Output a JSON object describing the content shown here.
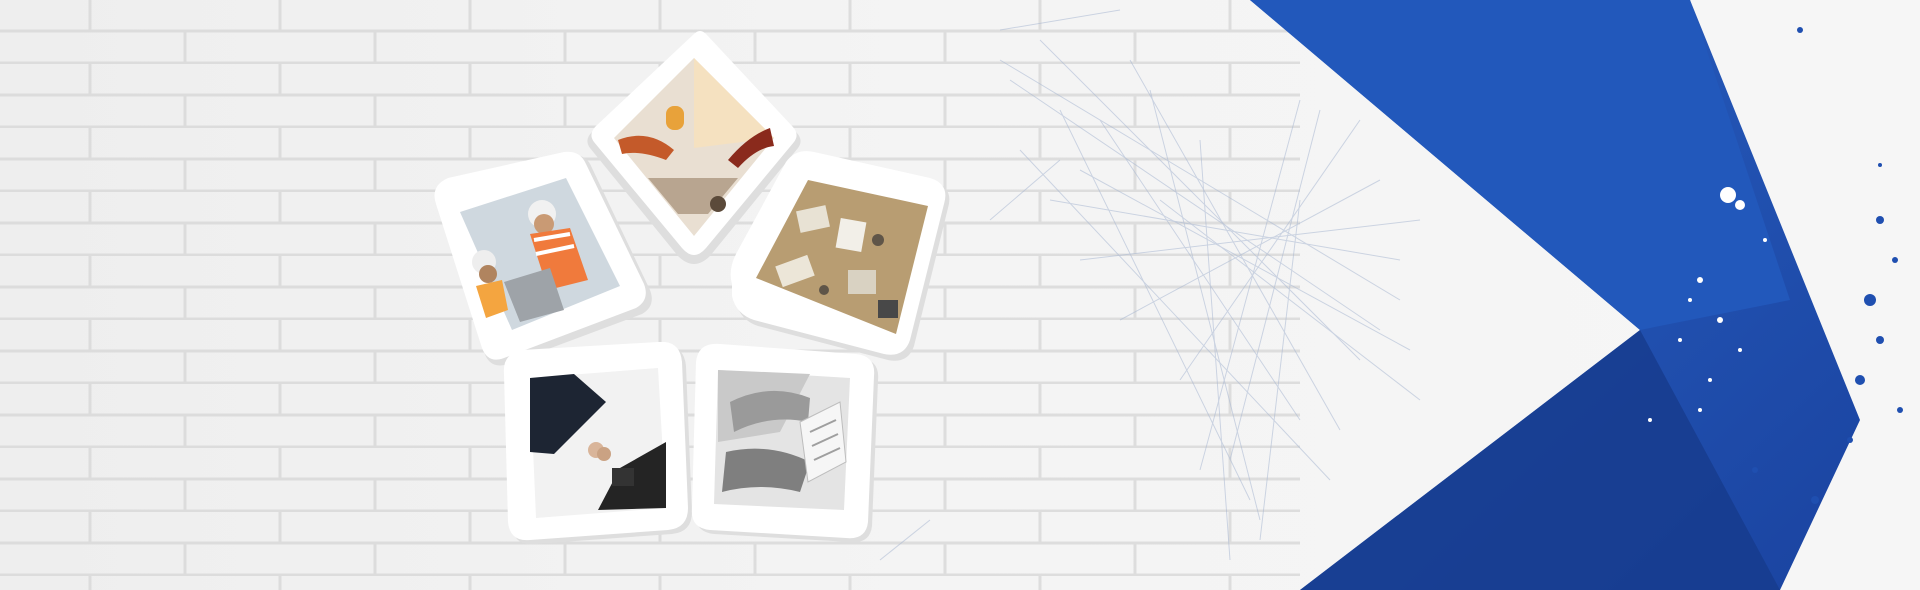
{
  "banner": {
    "colors": {
      "wall": "#f1f1f1",
      "brick_line": "#dcdcdc",
      "arrow_blue": "#1f4fb0",
      "arrow_dark": "#163b8c",
      "frame": "#ffffff",
      "scratch": "#9fb0cc"
    },
    "tiles": [
      {
        "name": "tile-top",
        "photo": "hands-working-at-desk"
      },
      {
        "name": "tile-left",
        "photo": "engineers-in-hard-hats"
      },
      {
        "name": "tile-right",
        "photo": "office-desk-overhead"
      },
      {
        "name": "tile-bottom-left",
        "photo": "business-handshake"
      },
      {
        "name": "tile-bottom-right",
        "photo": "hand-on-calculator"
      }
    ]
  }
}
